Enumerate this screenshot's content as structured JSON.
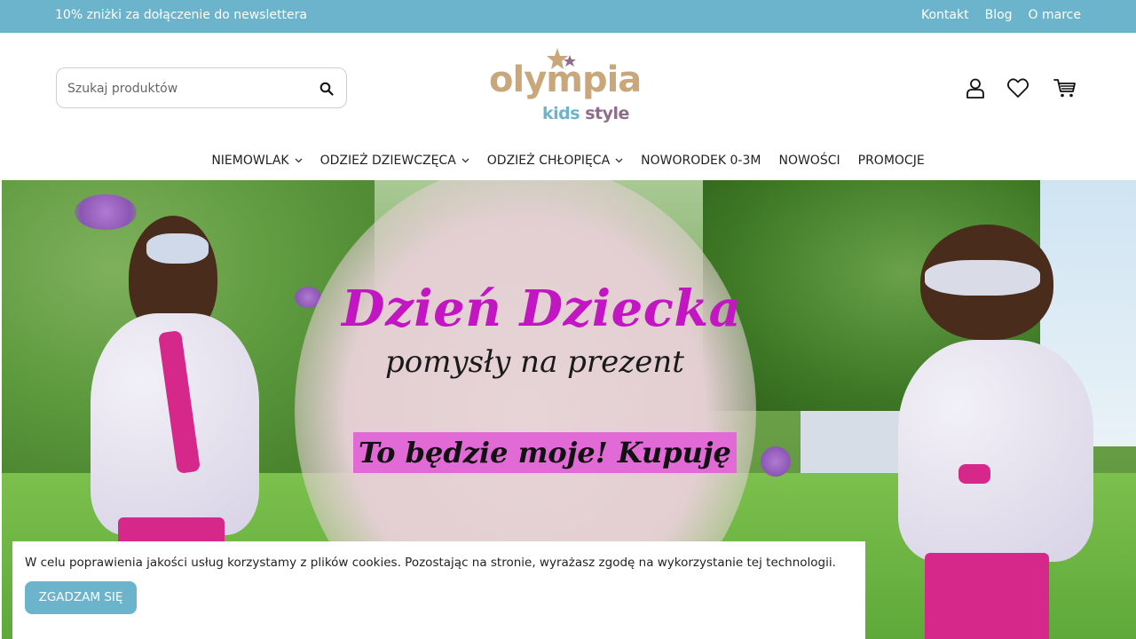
{
  "topbar": {
    "promo": "10% zniżki za dołączenie do newslettera",
    "links": [
      "Kontakt",
      "Blog",
      "O marce"
    ]
  },
  "search": {
    "placeholder": "Szukaj produktów"
  },
  "logo": {
    "word1": "olympia",
    "kids": "kids",
    "style": "style"
  },
  "header_icons": [
    "user-icon",
    "heart-icon",
    "cart-icon"
  ],
  "nav": {
    "items": [
      {
        "label": "NIEMOWLAK",
        "dropdown": true
      },
      {
        "label": "ODZIEŻ DZIEWCZĘCA",
        "dropdown": true
      },
      {
        "label": "ODZIEŻ CHŁOPIĘCA",
        "dropdown": true
      },
      {
        "label": "NOWORODEK 0-3M",
        "dropdown": false
      },
      {
        "label": "NOWOŚCI",
        "dropdown": false
      },
      {
        "label": "PROMOCJE",
        "dropdown": false
      }
    ]
  },
  "hero": {
    "title": "Dzień Dziecka",
    "subtitle": "pomysły na prezent",
    "cta": "To będzie moje! Kupuję"
  },
  "cookie": {
    "message": "W celu poprawienia jakości usług korzystamy z plików cookies. Pozostając na stronie, wyrażasz zgodę na wykorzystanie tej technologii.",
    "button": "ZGADZAM SIĘ"
  },
  "colors": {
    "accent": "#6cb4cb",
    "logo_gold": "#c9a77a",
    "logo_purple": "#8e6d8c",
    "hero_title": "#c116c2",
    "cta_bg": "#e26ad6"
  }
}
